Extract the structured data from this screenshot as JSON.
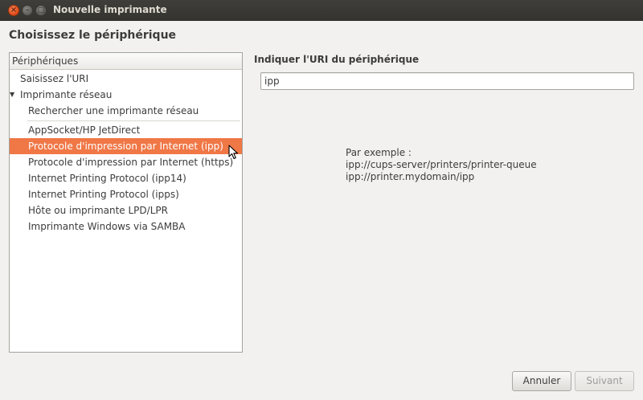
{
  "window": {
    "title": "Nouvelle imprimante"
  },
  "heading": "Choisissez le périphérique",
  "devices": {
    "header": "Périphériques",
    "items": [
      {
        "label": "Saisissez l'URI",
        "level": 0
      },
      {
        "label": "Imprimante réseau",
        "level": 0,
        "expanded": true
      },
      {
        "label": "Rechercher une imprimante réseau",
        "level": 1
      },
      {
        "label": "AppSocket/HP JetDirect",
        "level": 1
      },
      {
        "label": "Protocole d'impression par Internet (ipp)",
        "level": 1,
        "selected": true
      },
      {
        "label": "Protocole d'impression par Internet (https)",
        "level": 1
      },
      {
        "label": "Internet Printing Protocol (ipp14)",
        "level": 1
      },
      {
        "label": "Internet Printing Protocol (ipps)",
        "level": 1
      },
      {
        "label": "Hôte ou imprimante LPD/LPR",
        "level": 1
      },
      {
        "label": "Imprimante Windows via SAMBA",
        "level": 1
      }
    ]
  },
  "uri": {
    "label": "Indiquer l'URI du périphérique",
    "value": "ipp"
  },
  "example": {
    "title": "Par exemple :",
    "lines": [
      "ipp://cups-server/printers/printer-queue",
      "ipp://printer.mydomain/ipp"
    ]
  },
  "buttons": {
    "cancel": "Annuler",
    "next": "Suivant"
  },
  "colors": {
    "selection": "#f07746",
    "close_button": "#dd4814",
    "titlebar": "#3c3b37"
  }
}
